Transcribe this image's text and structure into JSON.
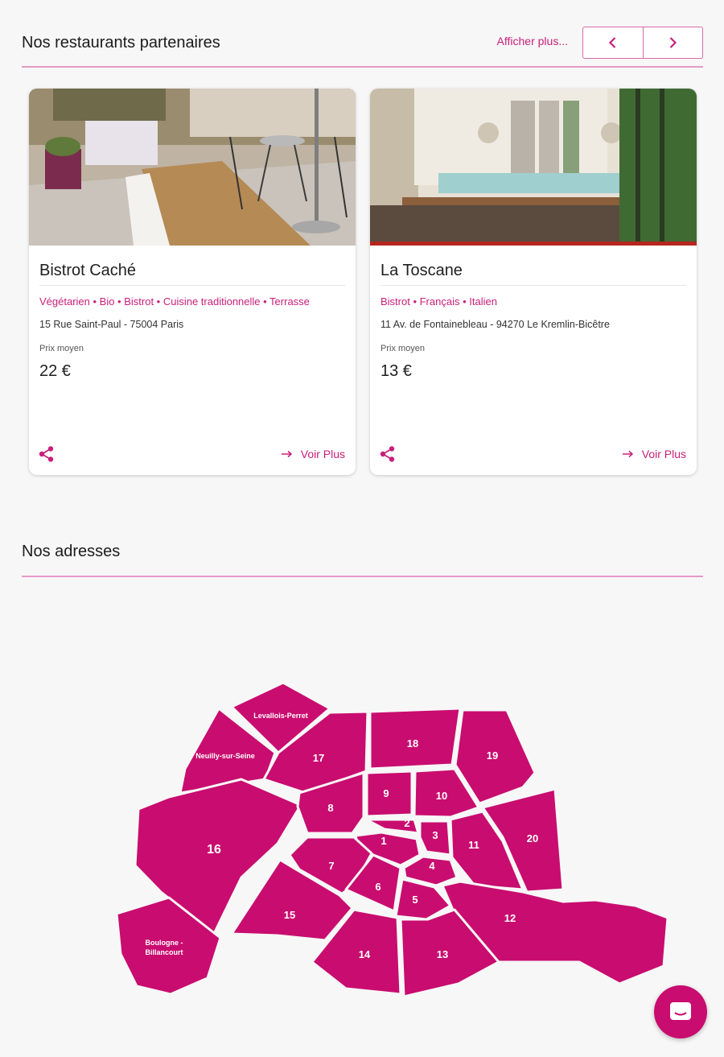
{
  "partners": {
    "title": "Nos restaurants partenaires",
    "more_label": "Afficher plus...",
    "prev_icon": "chevron-left-icon",
    "next_icon": "chevron-right-icon"
  },
  "restaurants": [
    {
      "name": "Bistrot Caché",
      "tags": "Végétarien • Bio • Bistrot • Cuisine traditionnelle • Terrasse",
      "address": "15 Rue Saint-Paul - 75004 Paris",
      "price_label": "Prix moyen",
      "price": "22 €",
      "voir_label": "Voir Plus"
    },
    {
      "name": "La Toscane",
      "tags": "Bistrot • Français • Italien",
      "address": "11 Av. de Fontainebleau - 94270 Le Kremlin-Bicêtre",
      "price_label": "Prix moyen",
      "price": "13 €",
      "voir_label": "Voir Plus"
    }
  ],
  "addresses": {
    "title": "Nos adresses",
    "districts": {
      "d1": "1",
      "d2": "2",
      "d3": "3",
      "d4": "4",
      "d5": "5",
      "d6": "6",
      "d7": "7",
      "d8": "8",
      "d9": "9",
      "d10": "10",
      "d11": "11",
      "d12": "12",
      "d13": "13",
      "d14": "14",
      "d15": "15",
      "d16": "16",
      "d17": "17",
      "d18": "18",
      "d19": "19",
      "d20": "20",
      "levallois": "Levallois-Perret",
      "neuilly": "Neuilly-sur-Seine",
      "boulogne_1": "Boulogne -",
      "boulogne_2": "Billancourt"
    }
  },
  "colors": {
    "accent": "#c90c6f",
    "link": "#c8207a",
    "rule": "#e39ac4"
  },
  "chat": {
    "icon": "chat-icon"
  }
}
